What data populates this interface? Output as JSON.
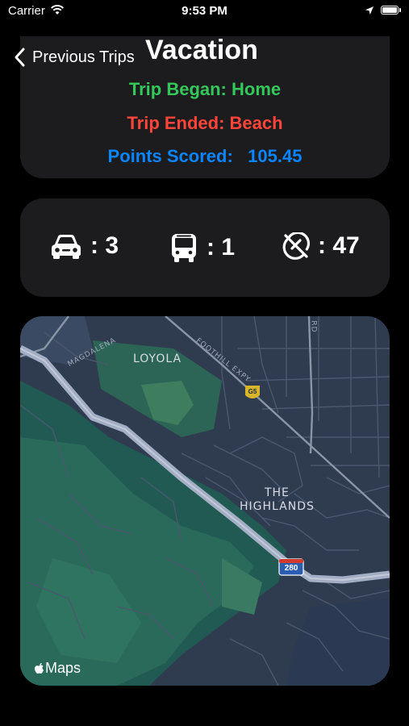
{
  "status_bar": {
    "carrier": "Carrier",
    "time": "9:53 PM"
  },
  "nav": {
    "back_label": "Previous Trips"
  },
  "trip": {
    "title": "Vacation",
    "began": "Trip Began: Home",
    "ended": "Trip Ended: Beach",
    "points_label": "Points Scored:",
    "points_value": "105.45"
  },
  "stats": {
    "car": {
      "icon": "car-icon",
      "value": ": 3"
    },
    "bus": {
      "icon": "bus-icon",
      "value": ": 1"
    },
    "none": {
      "icon": "no-transport-icon",
      "value": ": 47"
    }
  },
  "map": {
    "labels": {
      "loyola": "LOYOLA",
      "highlands_1": "THE",
      "highlands_2": "HIGHLANDS"
    },
    "streets": {
      "magdalena": "MAGDALENA",
      "foothill": "FOOTHILL EXPY",
      "rd": "RD"
    },
    "shields": {
      "county": "G5",
      "interstate": "280"
    },
    "attribution": "Maps"
  },
  "colors": {
    "background": "#000000",
    "card": "#1c1c1e",
    "began": "#34c759",
    "ended": "#ff453a",
    "points": "#0a84ff"
  }
}
